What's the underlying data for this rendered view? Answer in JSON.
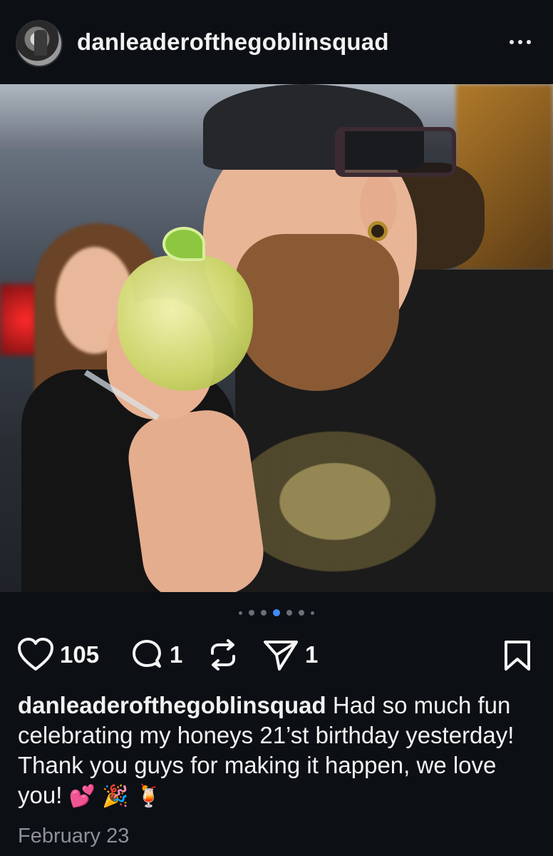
{
  "header": {
    "username": "danleaderofthegoblinsquad",
    "more_icon": "ellipsis-icon"
  },
  "carousel": {
    "slide_count": 7,
    "active_index": 3
  },
  "actions": {
    "like_count": "105",
    "comment_count": "1",
    "share_count": "1",
    "icons": [
      "heart-icon",
      "comment-icon",
      "repost-icon",
      "share-icon",
      "bookmark-icon"
    ]
  },
  "caption": {
    "username": "danleaderofthegoblinsquad",
    "text": "Had so much fun celebrating my honeys 21’st birthday yesterday! Thank you guys for making it happen, we love you!",
    "emojis": "💕 🎉 🍹"
  },
  "date": "February 23",
  "colors": {
    "background": "#0c0f14",
    "active_dot": "#3f8cff",
    "muted_text": "#8e9099"
  }
}
